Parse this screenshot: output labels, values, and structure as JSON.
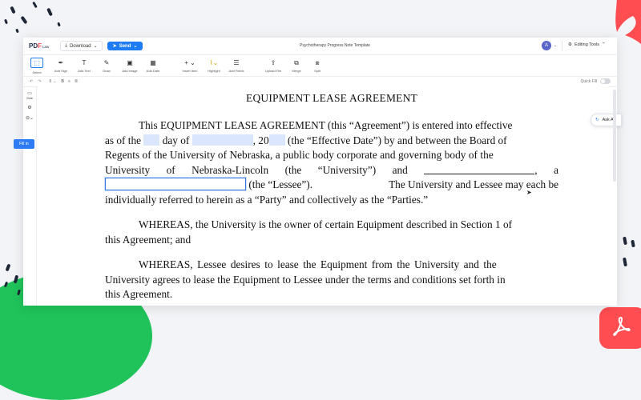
{
  "app": {
    "logo": {
      "p1": "PD",
      "p2": "F",
      "p3": "Law"
    },
    "download_label": "Download",
    "send_label": "Send",
    "document_title": "Psychotherapy Progress Note Template",
    "avatar_initial": "A",
    "editing_tools_label": "Editing Tools"
  },
  "toolbar": {
    "tools": [
      {
        "label": "Select",
        "icon": "select-icon"
      },
      {
        "label": "Add Sign",
        "icon": "signature-icon"
      },
      {
        "label": "Add Text",
        "icon": "text-icon"
      },
      {
        "label": "Draw",
        "icon": "pen-icon"
      },
      {
        "label": "Add Image",
        "icon": "image-icon"
      },
      {
        "label": "Add Date",
        "icon": "calendar-icon"
      },
      {
        "label": "Insert Item",
        "icon": "plus-icon"
      },
      {
        "label": "Highlight",
        "icon": "highlight-icon"
      },
      {
        "label": "Add Fields",
        "icon": "fields-icon"
      },
      {
        "label": "Upload File",
        "icon": "upload-icon"
      },
      {
        "label": "Merge",
        "icon": "merge-icon"
      },
      {
        "label": "Split",
        "icon": "split-icon"
      }
    ]
  },
  "subbar": {
    "font_size": "8",
    "quick_fill_label": "Quick Fill"
  },
  "leftrail": {
    "sidebar_label": "Side"
  },
  "document": {
    "title": "EQUIPMENT LEASE AGREEMENT",
    "p1": {
      "l1": "This EQUIPMENT LEASE AGREEMENT (this “Agreement”) is entered into effective",
      "l2a": "as of the",
      "l2b": "day of",
      "l2c": ", 20",
      "l2d": "(the “Effective Date”) by and between the Board of",
      "l3": "Regents of the University of Nebraska, a public body corporate and governing body of the",
      "l4a": "University",
      "l4b": "of",
      "l4c": "Nebraska-Lincoln",
      "l4d": "(the",
      "l4e": "“University”)",
      "l4f": "and",
      "l4g": ",",
      "l4h": "a",
      "l5a": "(the “Lessee”).",
      "l5b": "The University and Lessee may each be",
      "l6": "individually referred to herein as a “Party” and collectively as the “Parties.”"
    },
    "p2": {
      "l1": "WHEREAS, the University is the owner of certain Equipment described in Section 1 of",
      "l2": "this Agreement; and"
    },
    "p3": {
      "l1": "WHEREAS, Lessee desires to lease the Equipment from the University and the",
      "l2": "University agrees to lease the Equipment to Lessee under the terms and conditions set forth in",
      "l3": "this Agreement."
    }
  },
  "fill_in_label": "Fill in",
  "ask_ai_label": "Ask AI",
  "colors": {
    "accent": "#1f7cf2",
    "field_fill": "#d9e6fb",
    "brand_red": "#ff4d52",
    "brand_green": "#1fc35a"
  }
}
